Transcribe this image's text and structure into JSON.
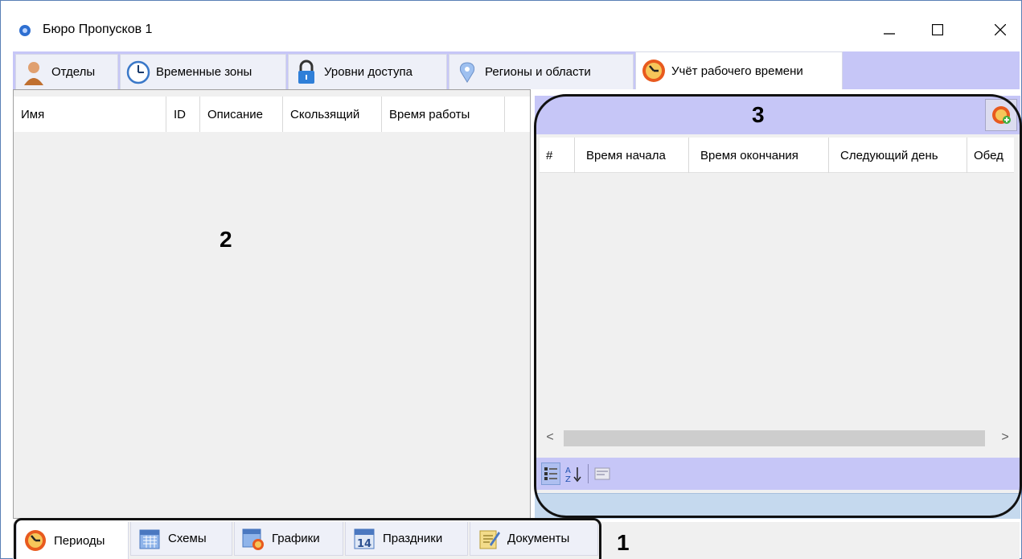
{
  "window": {
    "title": "Бюро Пропусков 1",
    "controls": {
      "minimize": "minimize",
      "maximize": "maximize",
      "close": "close"
    }
  },
  "top_tabs": [
    {
      "label": "Отделы",
      "icon": "person-icon",
      "active": false
    },
    {
      "label": "Временные зоны",
      "icon": "clock-icon",
      "active": false
    },
    {
      "label": "Уровни доступа",
      "icon": "lock-icon",
      "active": false
    },
    {
      "label": "Регионы и области",
      "icon": "map-pin-icon",
      "active": false
    },
    {
      "label": "Учёт рабочего времени",
      "icon": "time-tracking-icon",
      "active": true
    }
  ],
  "left_table": {
    "columns": [
      "Имя",
      "ID",
      "Описание",
      "Скользящий",
      "Время работы"
    ],
    "rows": []
  },
  "right_table": {
    "columns": [
      "#",
      "Время начала",
      "Время окончания",
      "Следующий день",
      "Обед"
    ],
    "rows": [],
    "scroll_left": "<",
    "scroll_right": ">"
  },
  "toolbar": {
    "sort_categorized": "categorized-icon",
    "sort_alpha": "sort-az-icon",
    "property_pages": "property-pages-icon"
  },
  "bottom_tabs": [
    {
      "label": "Периоды",
      "icon": "periods-icon",
      "active": true
    },
    {
      "label": "Схемы",
      "icon": "calendar-icon",
      "active": false
    },
    {
      "label": "Графики",
      "icon": "schedule-icon",
      "active": false
    },
    {
      "label": "Праздники",
      "icon": "holiday-calendar-icon",
      "active": false
    },
    {
      "label": "Документы",
      "icon": "documents-icon",
      "active": false
    }
  ],
  "callouts": {
    "one": "1",
    "two": "2",
    "three": "3"
  },
  "colors": {
    "tab_strip": "#c6c6f7",
    "status_bar": "#c5d9ee",
    "panel_bg": "#f0f0f0"
  }
}
